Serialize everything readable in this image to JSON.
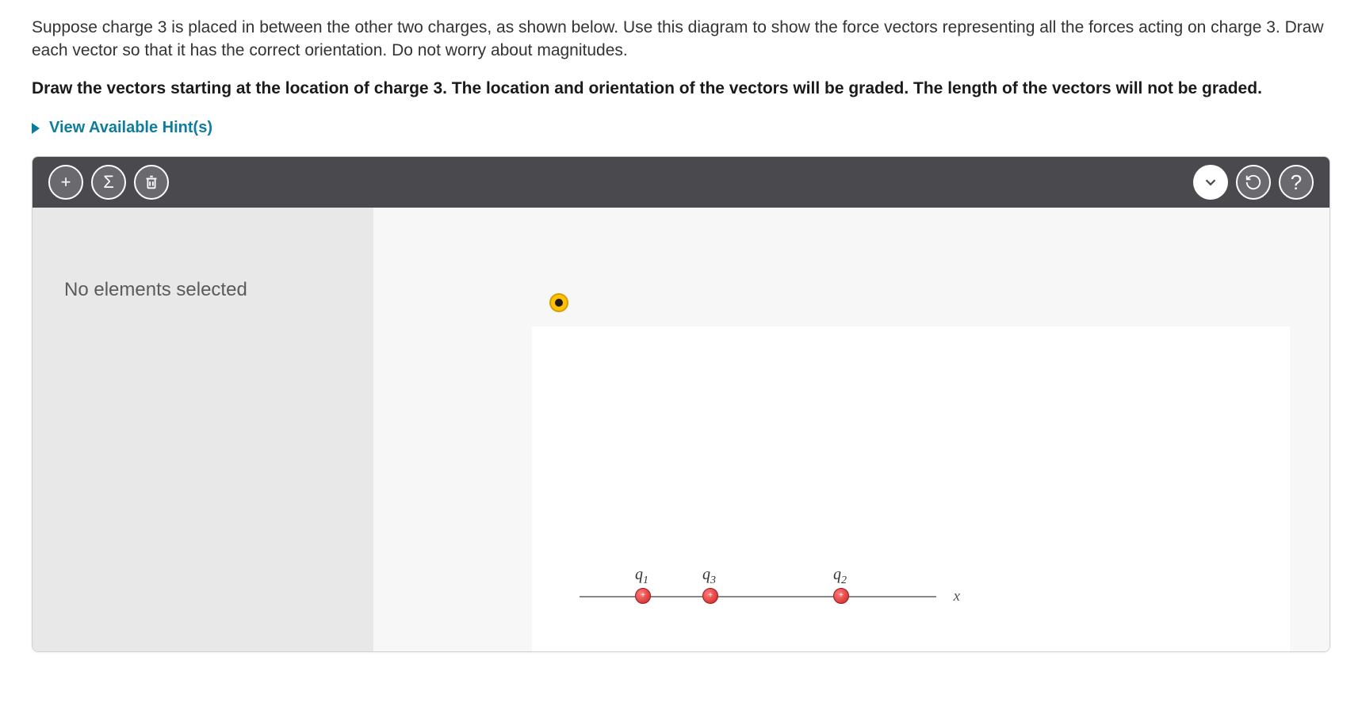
{
  "question": {
    "paragraph1": "Suppose charge 3 is placed in between the other two charges, as shown below. Use this diagram to show the force vectors representing all the forces acting on charge 3. Draw each vector so that it has the correct orientation. Do not worry about magnitudes.",
    "paragraph2": "Draw the vectors starting at the location of charge 3. The location and orientation of the vectors will be graded. The length of the vectors will not be graded."
  },
  "hints_label": "View Available Hint(s)",
  "sidebar": {
    "message": "No elements selected"
  },
  "toolbar": {
    "add": "+",
    "sum": "Σ"
  },
  "diagram": {
    "charges": [
      {
        "label_var": "q",
        "label_sub": "1",
        "symbol": "+"
      },
      {
        "label_var": "q",
        "label_sub": "3",
        "symbol": "+"
      },
      {
        "label_var": "q",
        "label_sub": "2",
        "symbol": "+"
      }
    ],
    "axis": "x"
  }
}
